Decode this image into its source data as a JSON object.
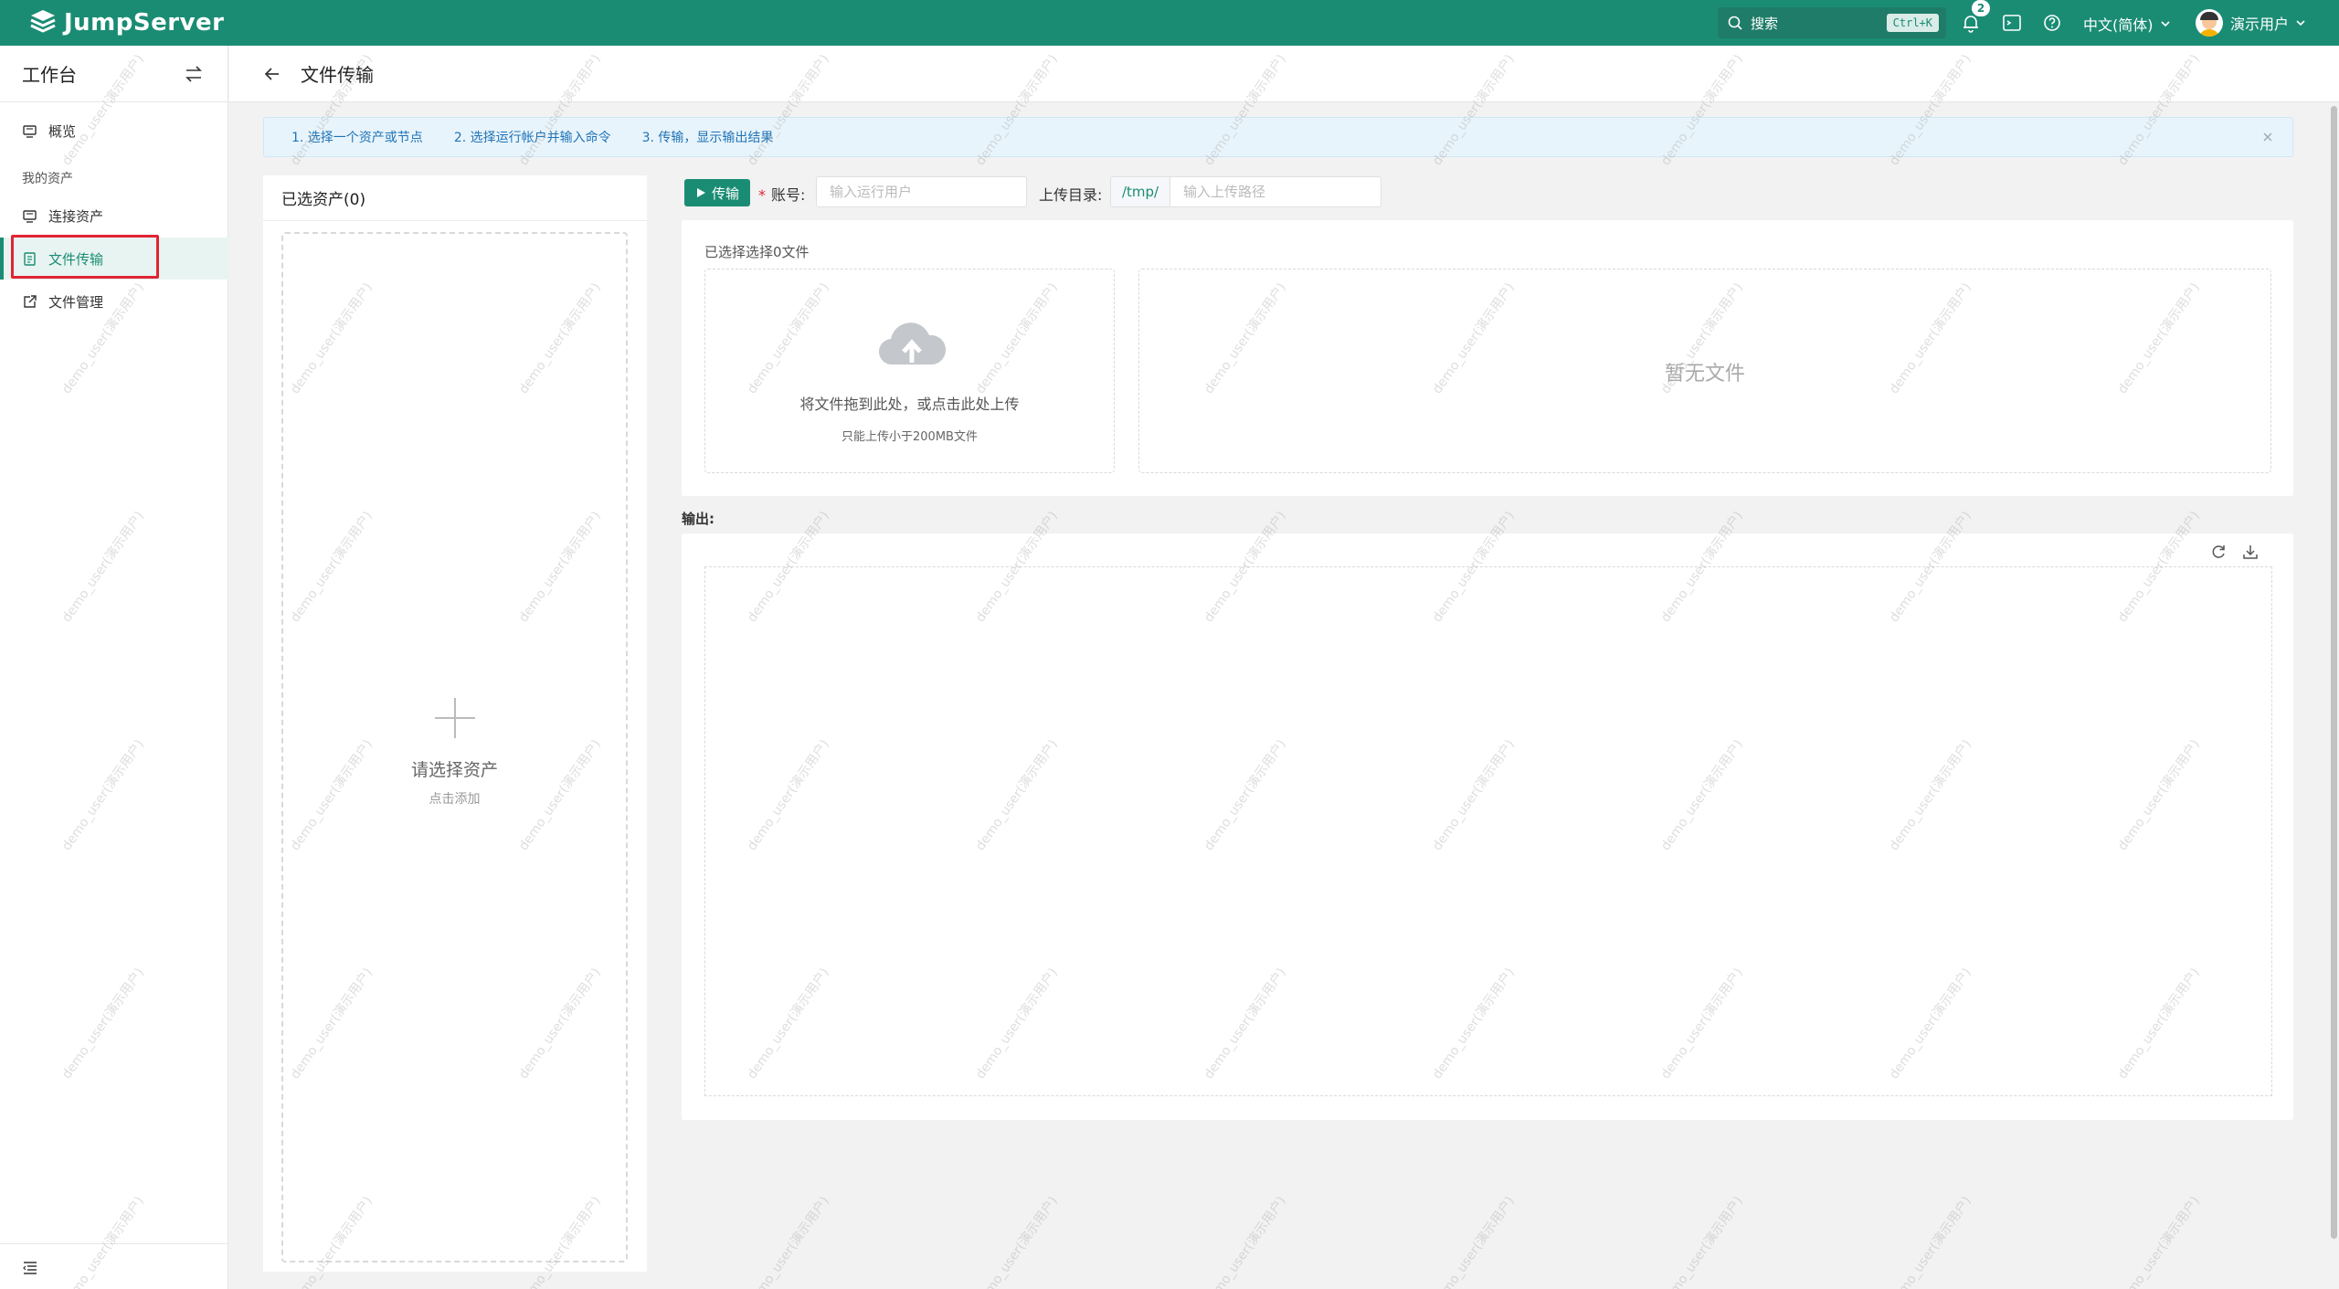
{
  "topbar": {
    "brand": "JumpServer",
    "search_placeholder": "搜索",
    "search_shortcut": "Ctrl+K",
    "notification_count": "2",
    "language": "中文(简体)",
    "user_name": "演示用户",
    "brand_color": "#1a8c74"
  },
  "sidebar": {
    "title": "工作台",
    "group_my_assets": "我的资产",
    "items": [
      {
        "label": "概览",
        "icon": "monitor-icon"
      },
      {
        "label": "连接资产",
        "icon": "monitor-icon"
      },
      {
        "label": "文件传输",
        "icon": "file-icon",
        "active": true
      },
      {
        "label": "文件管理",
        "icon": "external-link-icon"
      }
    ]
  },
  "page": {
    "title": "文件传输"
  },
  "banner": {
    "steps": [
      "1. 选择一个资产或节点",
      "2. 选择运行帐户并输入命令",
      "3. 传输，显示输出结果"
    ]
  },
  "assets": {
    "header": "已选资产(0)",
    "placeholder_title": "请选择资产",
    "placeholder_sub": "点击添加"
  },
  "toolbar": {
    "transfer_label": "传输",
    "account_label": "账号:",
    "account_placeholder": "输入运行用户",
    "dir_label": "上传目录:",
    "dir_prefix": "/tmp/",
    "dir_placeholder": "输入上传路径"
  },
  "upload": {
    "selected_text": "已选择选择0文件",
    "drop_text": "将文件拖到此处，或点击此处上传",
    "drop_sub": "只能上传小于200MB文件",
    "empty_text": "暂无文件"
  },
  "output": {
    "label": "输出:"
  },
  "watermark": {
    "text": "demo_user(演示用户)"
  }
}
